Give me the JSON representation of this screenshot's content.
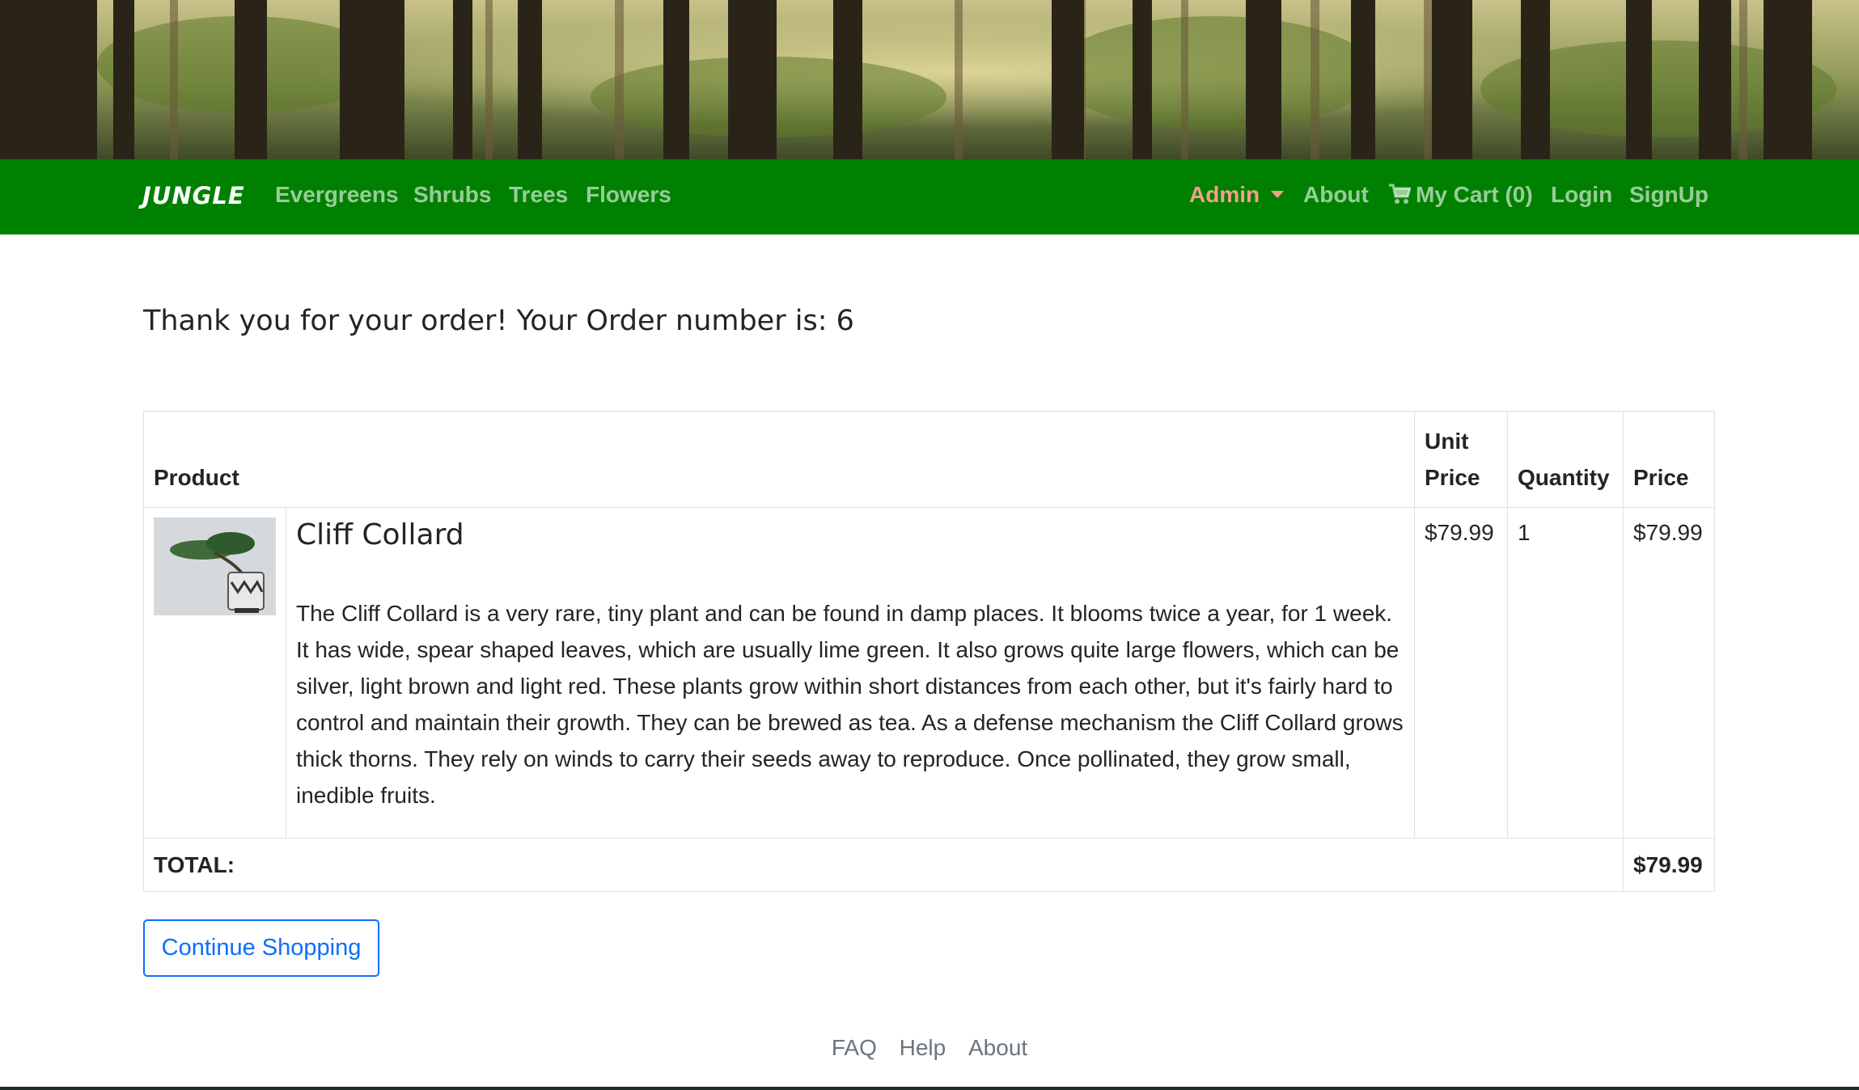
{
  "navbar": {
    "brand": "JUNGLE",
    "left_links": [
      "Evergreens",
      "Shrubs",
      "Trees",
      "Flowers"
    ],
    "admin_label": "Admin",
    "about_label": "About",
    "cart_label": "My Cart (0)",
    "login_label": "Login",
    "signup_label": "SignUp",
    "colors": {
      "bar": "#008000",
      "admin": "#f5a08a"
    }
  },
  "main": {
    "heading": "Thank you for your order! Your Order number is: 6",
    "table": {
      "headers": {
        "product": "Product",
        "unit_price": "Unit Price",
        "quantity": "Quantity",
        "price": "Price"
      },
      "items": [
        {
          "name": "Cliff Collard",
          "description": "The Cliff Collard is a very rare, tiny plant and can be found in damp places. It blooms twice a year, for 1 week. It has wide, spear shaped leaves, which are usually lime green. It also grows quite large flowers, which can be silver, light brown and light red. These plants grow within short distances from each other, but it's fairly hard to control and maintain their growth. They can be brewed as tea. As a defense mechanism the Cliff Collard grows thick thorns. They rely on winds to carry their seeds away to reproduce. Once pollinated, they grow small, inedible fruits.",
          "unit_price": "$79.99",
          "quantity": "1",
          "price": "$79.99"
        }
      ],
      "total_label": "TOTAL:",
      "total_value": "$79.99"
    },
    "continue_button": "Continue Shopping"
  },
  "footer": {
    "links": [
      "FAQ",
      "Help",
      "About"
    ]
  }
}
